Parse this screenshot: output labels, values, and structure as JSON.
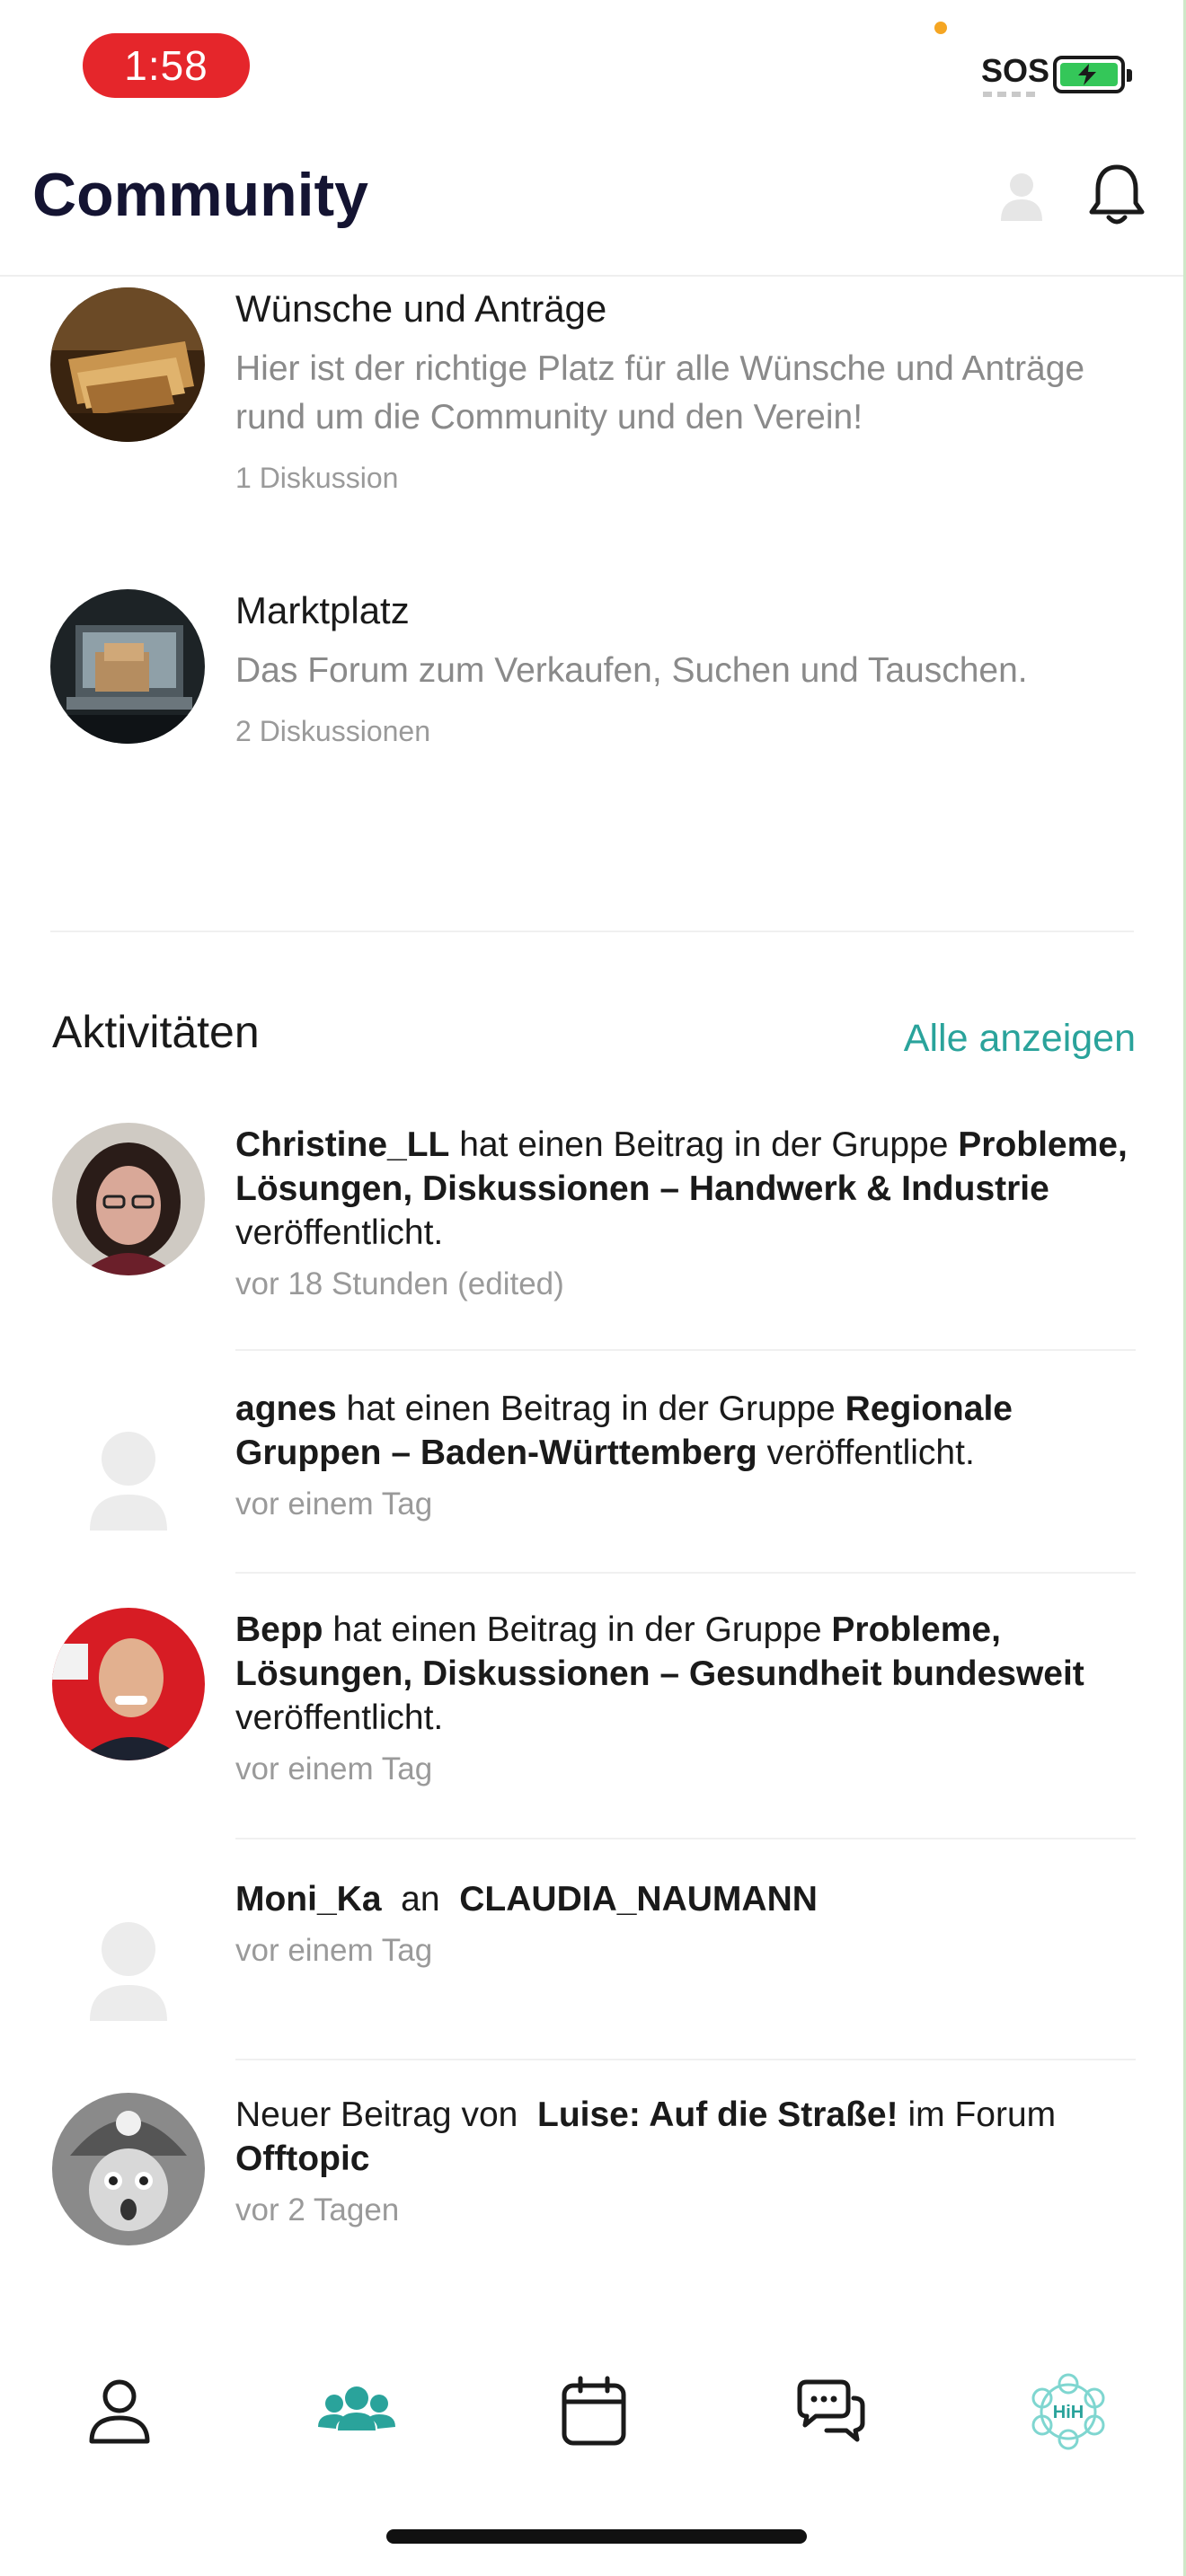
{
  "status_bar": {
    "time": "1:58",
    "sos": "SOS"
  },
  "header": {
    "title": "Community"
  },
  "forums": [
    {
      "title": "Wünsche und Anträge",
      "description": "Hier ist der richtige Platz für alle Wünsche und Anträge rund um die Community und den Verein!",
      "count": "1 Diskussion"
    },
    {
      "title": "Marktplatz",
      "description": "Das Forum zum Verkaufen, Suchen und Tauschen.",
      "count": "2 Diskussionen"
    }
  ],
  "activities": {
    "title": "Aktivitäten",
    "show_all": "Alle anzeigen",
    "items": [
      {
        "user": "Christine_LL",
        "text1": " hat einen Beitrag in der Gruppe ",
        "target": "Probleme, Lösungen, Diskussionen – Handwerk & Industrie",
        "text2": " veröffentlicht.",
        "time": "vor 18 Stunden (edited)"
      },
      {
        "user": "agnes",
        "text1": " hat einen Beitrag in der Gruppe ",
        "target": "Regionale Gruppen – Baden-Württemberg",
        "text2": " veröffentlicht.",
        "time": "vor einem Tag"
      },
      {
        "user": "Bepp",
        "text1": " hat einen Beitrag in der Gruppe ",
        "target": "Probleme, Lösungen, Diskussionen – Gesundheit bundesweit",
        "text2": " veröffentlicht.",
        "time": "vor einem Tag"
      },
      {
        "user": "Moni_Ka",
        "text1": "  an  ",
        "target": "CLAUDIA_NAUMANN",
        "text2": "",
        "time": "vor einem Tag"
      },
      {
        "prefix": "Neuer Beitrag von  ",
        "user": "Luise: Auf die Straße!",
        "text1": " im Forum ",
        "target": "Offtopic",
        "text2": "",
        "time": "vor 2 Tagen"
      }
    ]
  },
  "bottom_nav": {
    "items": [
      {
        "icon": "person-icon"
      },
      {
        "icon": "community-icon",
        "active": true
      },
      {
        "icon": "calendar-icon"
      },
      {
        "icon": "chat-icon"
      },
      {
        "icon": "hih-logo-icon"
      }
    ]
  },
  "colors": {
    "accent": "#2aa39b",
    "title": "#141432",
    "status_pill": "#e5262b"
  }
}
